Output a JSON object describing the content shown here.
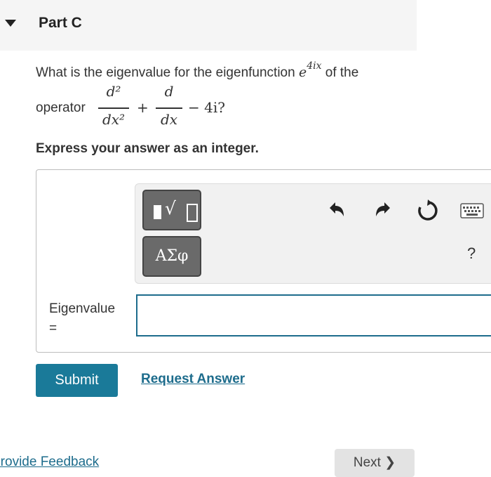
{
  "part": {
    "title": "Part C"
  },
  "question": {
    "prefix": "What is the eigenvalue for the eigenfunction",
    "eigenfunction_base": "e",
    "eigenfunction_exp": "4ix",
    "suffix": "of the",
    "operator_label": "operator",
    "frac1_num": "d²",
    "frac1_den": "dx²",
    "plus": "+",
    "frac2_num": "d",
    "frac2_den": "dx",
    "tail": "− 4i?"
  },
  "instruction": "Express your answer as an integer.",
  "toolbar": {
    "templates_icon": "templates-sqrt-icon",
    "symbols_label": "ΑΣφ",
    "undo_icon": "undo-icon",
    "redo_icon": "redo-icon",
    "reset_icon": "reset-icon",
    "keyboard_icon": "keyboard-icon",
    "help_label": "?"
  },
  "answer": {
    "label_line1": "Eigenvalue",
    "label_line2": "=",
    "value": ""
  },
  "actions": {
    "submit_label": "Submit",
    "request_answer_label": "Request Answer"
  },
  "footer": {
    "feedback_label": "Provide Feedback",
    "next_label": "Next ❯"
  },
  "colors": {
    "accent": "#1a7a99",
    "link": "#1d6c8c",
    "header_bg": "#f5f5f5",
    "tool_button": "#6a6a6a"
  }
}
